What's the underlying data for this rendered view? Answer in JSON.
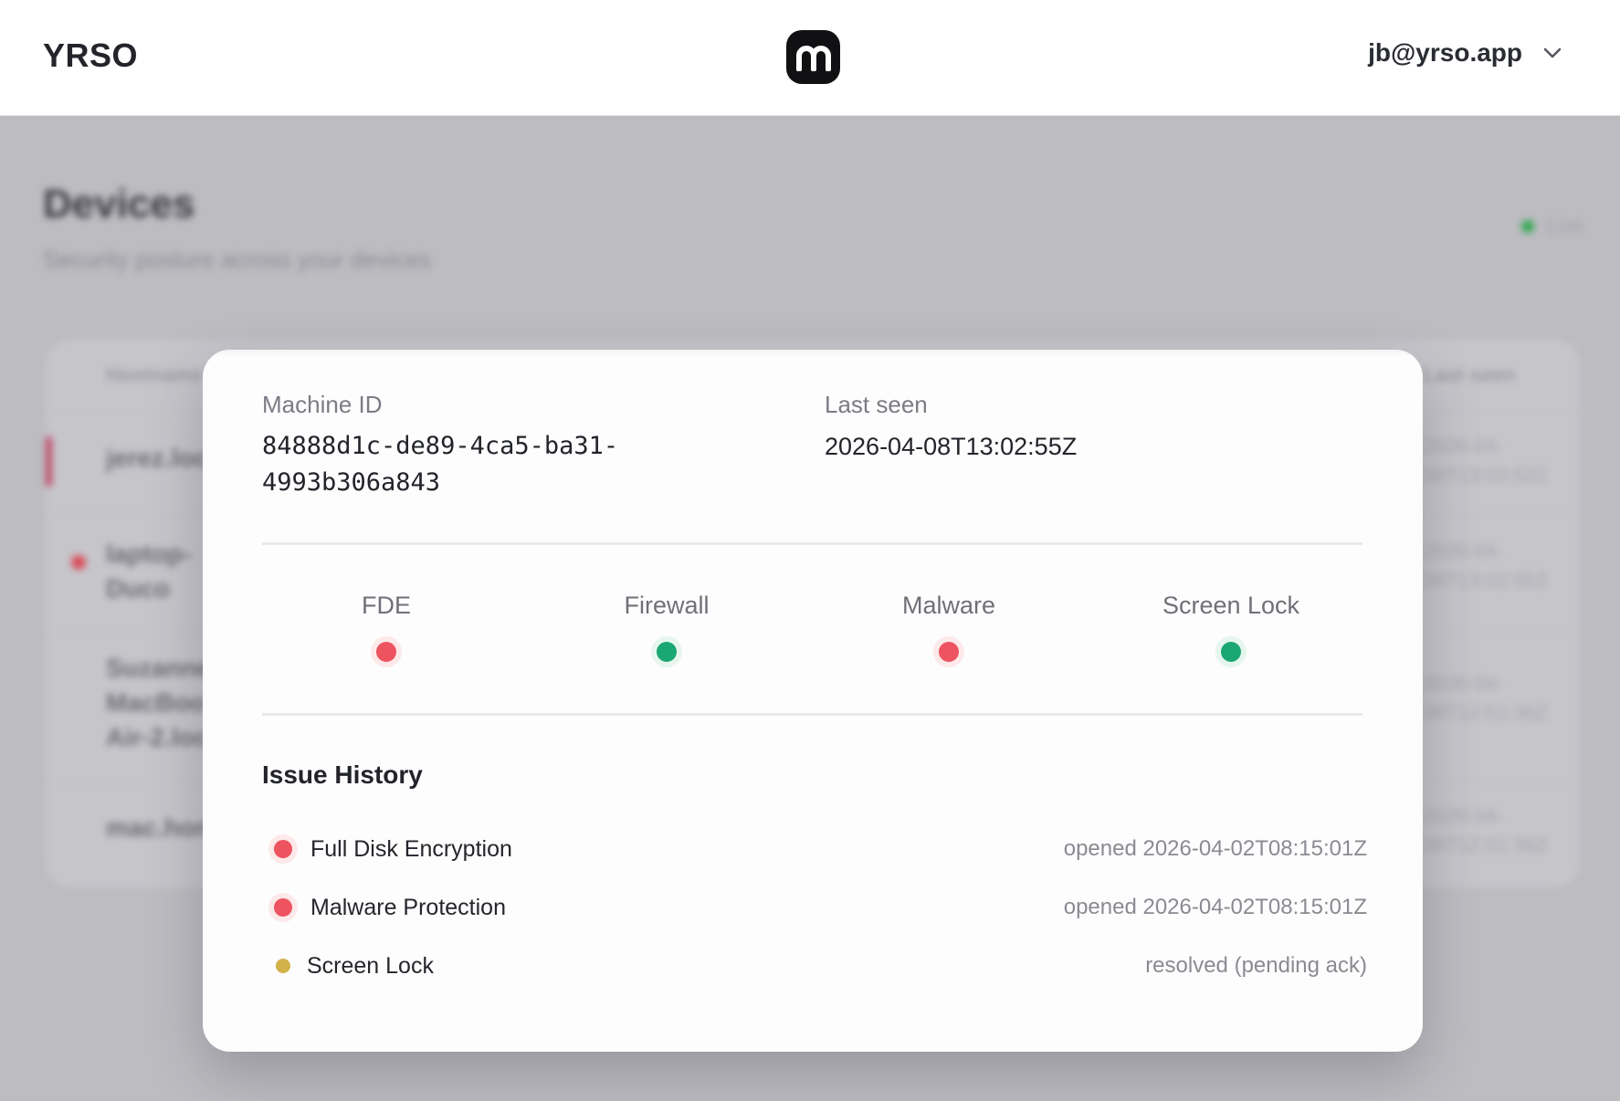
{
  "header": {
    "brand": "YRSO",
    "logo_icon": "m-logo-icon",
    "user_email": "jb@yrso.app",
    "menu_icon": "chevron-down-icon"
  },
  "background": {
    "title": "Devices",
    "subtitle": "Security posture across your devices",
    "live_label": "Live",
    "columns": [
      "Hostname",
      "Last seen"
    ],
    "rows": [
      {
        "hostname": "jerez.loc",
        "last_seen": "2026-04-\n08T13:03:52Z"
      },
      {
        "hostname": "laptop-\nDuco",
        "last_seen": "2026-04-\n08T13:02:55Z"
      },
      {
        "hostname": "Suzanne\nMacBoo\nAir-2.loc",
        "last_seen": "2026-04-\n08T12:51:36Z"
      },
      {
        "hostname": "mac.hon",
        "last_seen": "2026-04-\n08T12:51:36Z"
      }
    ]
  },
  "modal": {
    "machine_id_label": "Machine ID",
    "machine_id": "84888d1c-de89-4ca5-ba31-4993b306a843",
    "last_seen_label": "Last seen",
    "last_seen": "2026-04-08T13:02:55Z",
    "checks": [
      {
        "label": "FDE",
        "status": "fail",
        "color": "#ee5360"
      },
      {
        "label": "Firewall",
        "status": "pass",
        "color": "#1ba774"
      },
      {
        "label": "Malware",
        "status": "fail",
        "color": "#ee5360"
      },
      {
        "label": "Screen Lock",
        "status": "pass",
        "color": "#1ba774"
      }
    ],
    "issue_history_title": "Issue History",
    "issues": [
      {
        "name": "Full Disk Encryption",
        "status": "opened 2026-04-02T08:15:01Z",
        "color": "#ee5360"
      },
      {
        "name": "Malware Protection",
        "status": "opened 2026-04-02T08:15:01Z",
        "color": "#ee5360"
      },
      {
        "name": "Screen Lock",
        "status": "resolved (pending ack)",
        "color": "#d2b24a"
      }
    ]
  }
}
